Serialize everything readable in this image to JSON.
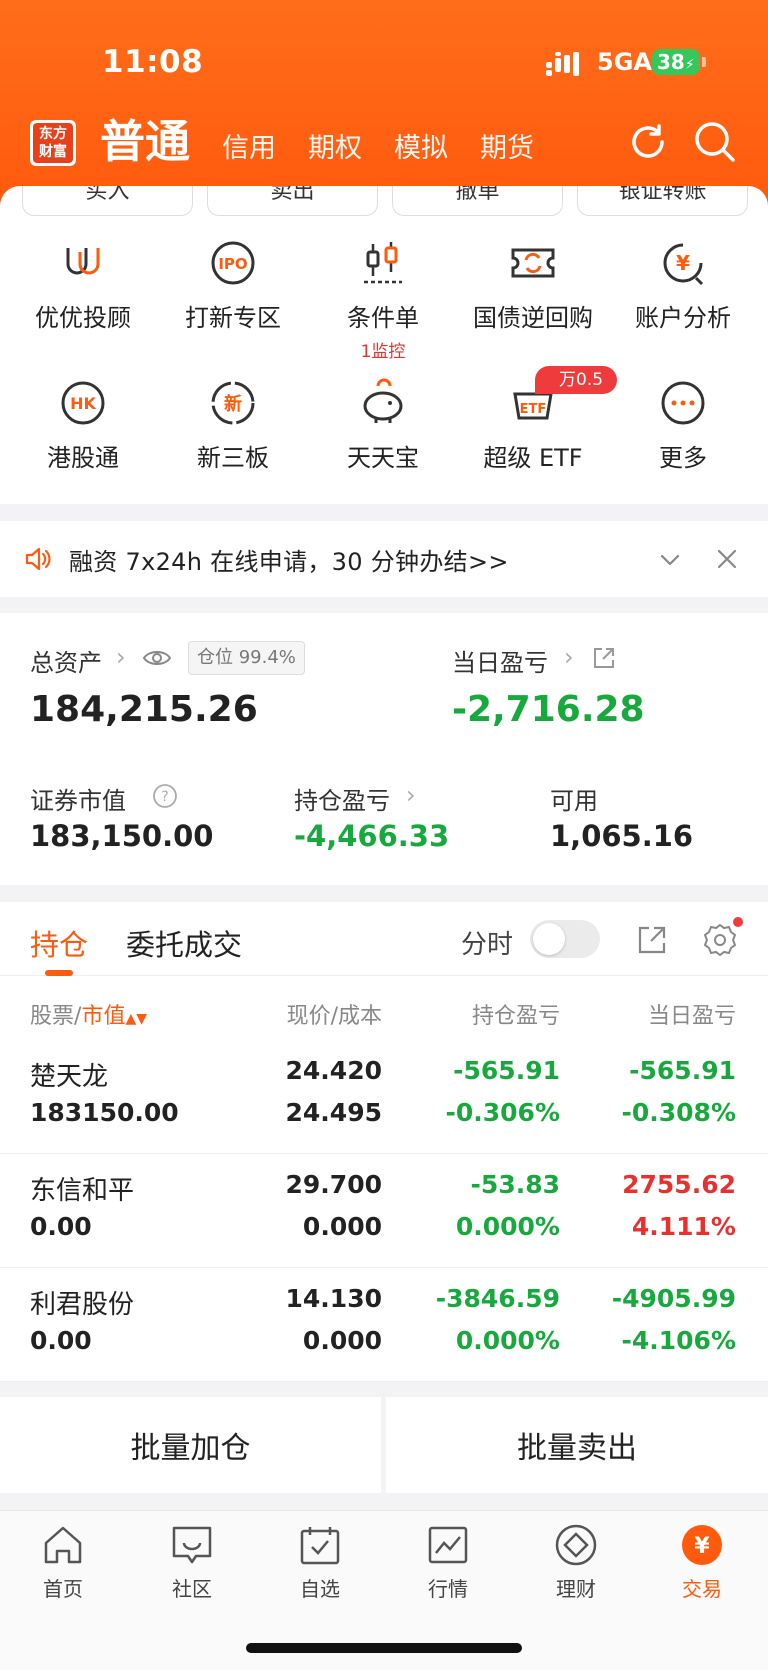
{
  "status": {
    "time": "11:08",
    "network": "5GA",
    "battery": "38"
  },
  "header": {
    "logo": "东方财富",
    "tabs": [
      "普通",
      "信用",
      "期权",
      "模拟",
      "期货"
    ]
  },
  "actions": [
    "买入",
    "卖出",
    "撤单",
    "银证转账"
  ],
  "grid": [
    {
      "label": "优优投顾",
      "icon": "uu-advisor-icon"
    },
    {
      "label": "打新专区",
      "icon": "ipo-icon"
    },
    {
      "label": "条件单",
      "sub": "1监控",
      "icon": "condition-order-icon"
    },
    {
      "label": "国债逆回购",
      "icon": "bond-repo-icon"
    },
    {
      "label": "账户分析",
      "icon": "account-analysis-icon"
    },
    {
      "label": "港股通",
      "icon": "hk-connect-icon"
    },
    {
      "label": "新三板",
      "icon": "neeq-icon"
    },
    {
      "label": "天天宝",
      "icon": "piggy-bank-icon"
    },
    {
      "label": "超级 ETF",
      "icon": "etf-icon"
    },
    {
      "label": "更多",
      "icon": "more-icon"
    }
  ],
  "etf_badge": "万0.5",
  "notice": {
    "text": "融资 7x24h 在线申请，30 分钟办结>>"
  },
  "assets": {
    "total_label": "总资产",
    "position_pill": "仓位 99.4%",
    "total_value": "184,215.26",
    "daily_label": "当日盈亏",
    "daily_value": "-2,716.28",
    "market_label": "证券市值",
    "market_value": "183,150.00",
    "holding_pnl_label": "持仓盈亏",
    "holding_pnl_value": "-4,466.33",
    "available_label": "可用",
    "available_value": "1,065.16"
  },
  "holdings": {
    "tab_active": "持仓",
    "tab_other": "委托成交",
    "fenshi": "分时",
    "headers": {
      "stock": "股票",
      "slash": "/",
      "market": "市值",
      "price": "现价/成本",
      "pnl": "持仓盈亏",
      "daily": "当日盈亏"
    },
    "rows": [
      {
        "name": "楚天龙",
        "mv": "183150.00",
        "price": "24.420",
        "cost": "24.495",
        "pnl": "-565.91",
        "pnl_pct": "-0.306%",
        "daily": "-565.91",
        "daily_pct": "-0.308%",
        "pnl_color": "green",
        "daily_color": "green"
      },
      {
        "name": "东信和平",
        "mv": "0.00",
        "price": "29.700",
        "cost": "0.000",
        "pnl": "-53.83",
        "pnl_pct": "0.000%",
        "daily": "2755.62",
        "daily_pct": "4.111%",
        "pnl_color": "green",
        "daily_color": "red"
      },
      {
        "name": "利君股份",
        "mv": "0.00",
        "price": "14.130",
        "cost": "0.000",
        "pnl": "-3846.59",
        "pnl_pct": "0.000%",
        "daily": "-4905.99",
        "daily_pct": "-4.106%",
        "pnl_color": "green",
        "daily_color": "green"
      }
    ]
  },
  "batch": {
    "add": "批量加仓",
    "sell": "批量卖出"
  },
  "nav": [
    {
      "label": "首页",
      "icon": "home-icon"
    },
    {
      "label": "社区",
      "icon": "community-icon"
    },
    {
      "label": "自选",
      "icon": "watchlist-icon"
    },
    {
      "label": "行情",
      "icon": "market-icon"
    },
    {
      "label": "理财",
      "icon": "wealth-icon"
    },
    {
      "label": "交易",
      "icon": "trade-icon"
    }
  ],
  "colors": {
    "brand": "#ff5a0e",
    "up": "#e8302e",
    "down": "#18a93e"
  }
}
